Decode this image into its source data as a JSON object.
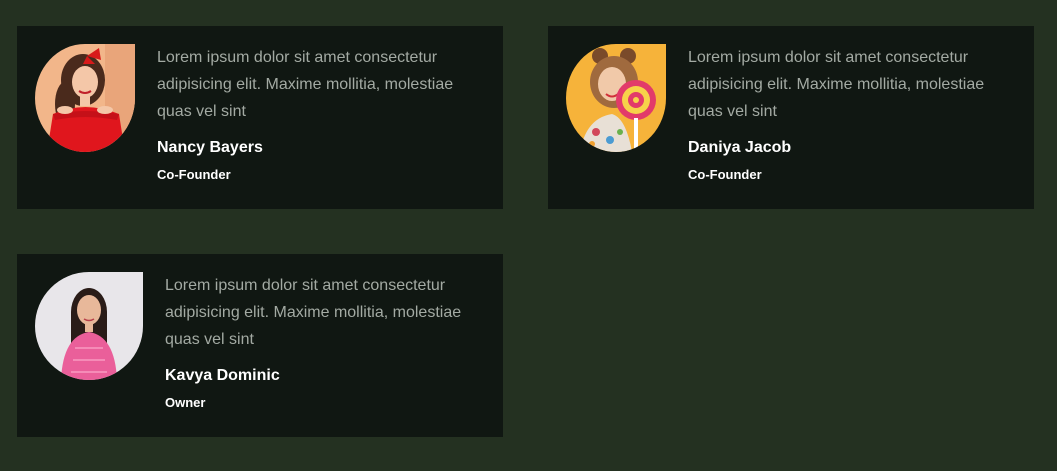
{
  "testimonials": [
    {
      "text": "Lorem ipsum dolor sit amet consectetur adipisicing elit. Maxime mollitia, molestiae quas vel sint",
      "name": "Nancy Bayers",
      "role": "Co-Founder",
      "photo_bg": "#f2b68a"
    },
    {
      "text": "Lorem ipsum dolor sit amet consectetur adipisicing elit. Maxime mollitia, molestiae quas vel sint",
      "name": "Daniya Jacob",
      "role": "Co-Founder",
      "photo_bg": "#f6b33a"
    },
    {
      "text": "Lorem ipsum dolor sit amet consectetur adipisicing elit. Maxime mollitia, molestiae quas vel sint",
      "name": "Kavya Dominic",
      "role": "Owner",
      "photo_bg": "#e8e6ea"
    }
  ],
  "colors": {
    "page_bg": "#243121",
    "card_bg": "#101712",
    "text_muted": "#a3aaa3",
    "text_strong": "#ffffff"
  }
}
